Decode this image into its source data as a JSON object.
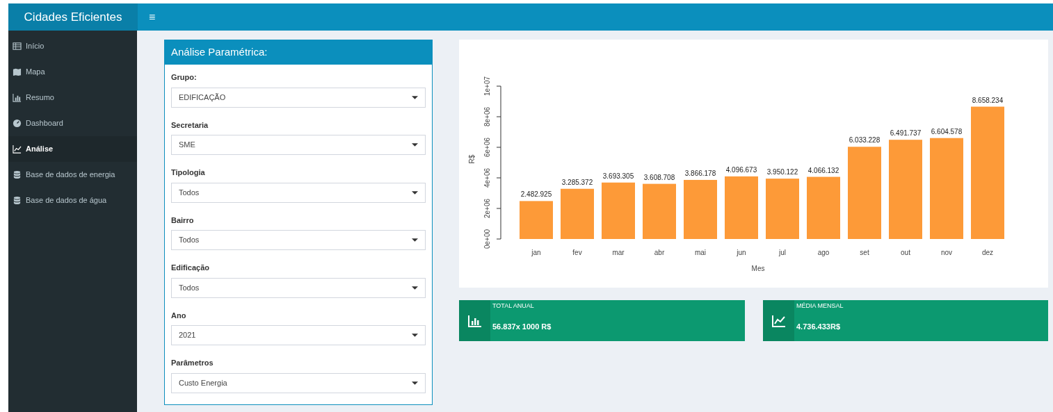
{
  "header": {
    "brand": "Cidades Eficientes",
    "menu_toggle": "≡"
  },
  "sidebar": {
    "items": [
      {
        "label": "Início",
        "kind": "table",
        "selected": false
      },
      {
        "label": "Mapa",
        "kind": "map",
        "selected": false
      },
      {
        "label": "Resumo",
        "kind": "chart",
        "selected": false
      },
      {
        "label": "Dashboard",
        "kind": "gauge",
        "selected": false
      },
      {
        "label": "Análise",
        "kind": "line",
        "selected": true
      },
      {
        "label": "Base de dados de energia",
        "kind": "database",
        "selected": false
      },
      {
        "label": "Base de dados de água",
        "kind": "database",
        "selected": false
      }
    ]
  },
  "panel": {
    "title": "Análise Paramétrica:",
    "fields": [
      {
        "label": "Grupo:",
        "value": "EDIFICAÇÃO"
      },
      {
        "label": "Secretaria",
        "value": "SME"
      },
      {
        "label": "Tipologia",
        "value": "Todos"
      },
      {
        "label": "Bairro",
        "value": "Todos"
      },
      {
        "label": "Edificação",
        "value": "Todos"
      },
      {
        "label": "Ano",
        "value": "2021"
      },
      {
        "label": "Parâmetros",
        "value": "Custo Energia"
      }
    ]
  },
  "chart": {
    "chart_data": {
      "type": "bar",
      "xlabel": "Mes",
      "ylabel": "R$",
      "categories": [
        "jan",
        "fev",
        "mar",
        "abr",
        "mai",
        "jun",
        "jul",
        "ago",
        "set",
        "out",
        "nov",
        "dez"
      ],
      "series": [
        {
          "color": "#fd9a38",
          "values": [
            2482925,
            3285372,
            3693305,
            3608708,
            3866178,
            4096673,
            3950122,
            4066132,
            6033228,
            6491737,
            6604578,
            8658234
          ]
        }
      ],
      "value_labels": [
        "2.482.925",
        "3.285.372",
        "3.693.305",
        "3.608.708",
        "3.866.178",
        "4.096.673",
        "3.950.122",
        "4.066.132",
        "6.033.228",
        "6.491.737",
        "6.604.578",
        "8.658.234"
      ],
      "ylim": [
        0,
        10000000
      ],
      "yticks": [
        {
          "value": 0,
          "label": "0e+00"
        },
        {
          "value": 2000000,
          "label": "2e+06"
        },
        {
          "value": 4000000,
          "label": "4e+06"
        },
        {
          "value": 6000000,
          "label": "6e+06"
        },
        {
          "value": 8000000,
          "label": "8e+06"
        },
        {
          "value": 10000000,
          "label": "1e+07"
        }
      ]
    }
  },
  "value_boxes": [
    {
      "label": "TOTAL ANUAL",
      "value": "56.837x 1000 R$",
      "kind": "bar"
    },
    {
      "label": "MÉDIA MENSAL",
      "value": "4.736.433R$",
      "kind": "line"
    }
  ]
}
